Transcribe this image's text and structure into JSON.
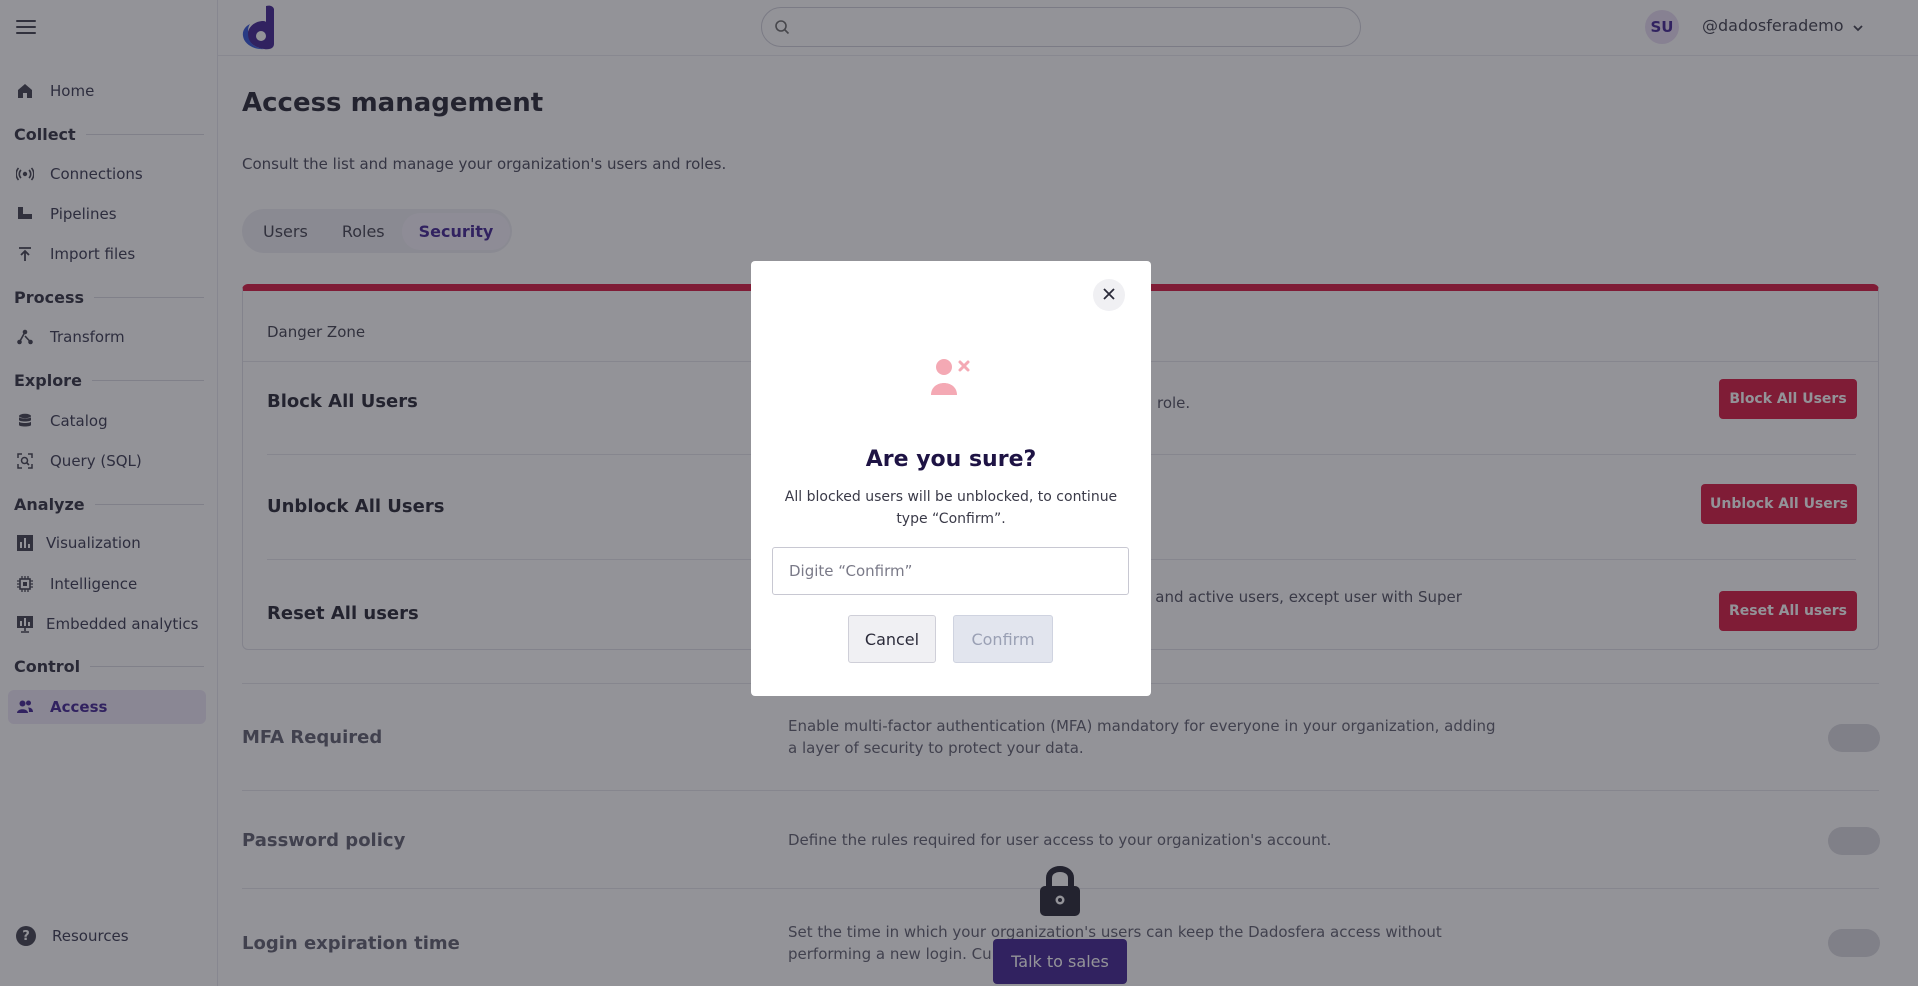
{
  "sidebar": {
    "home": "Home",
    "sections": {
      "collect": "Collect",
      "process": "Process",
      "explore": "Explore",
      "analyze": "Analyze",
      "control": "Control"
    },
    "items": {
      "connections": "Connections",
      "pipelines": "Pipelines",
      "import_files": "Import files",
      "transform": "Transform",
      "catalog": "Catalog",
      "query": "Query (SQL)",
      "visualization": "Visualization",
      "intelligence": "Intelligence",
      "embedded": "Embedded analytics",
      "access": "Access"
    },
    "resources": "Resources"
  },
  "header": {
    "avatar_initials": "SU",
    "username": "@dadosferademo"
  },
  "page": {
    "title": "Access management",
    "subtitle": "Consult the list and manage your organization's users and roles.",
    "tabs": [
      "Users",
      "Roles",
      "Security"
    ],
    "active_tab": "Security"
  },
  "danger_zone": {
    "title": "Danger Zone",
    "rows": [
      {
        "title": "Block All Users",
        "desc": "role.",
        "button": "Block All Users"
      },
      {
        "title": "Unblock All Users",
        "desc": "",
        "button": "Unblock All Users"
      },
      {
        "title": "Reset All users",
        "desc": "g and active users, except user with Super",
        "button": "Reset All users"
      }
    ]
  },
  "features": [
    {
      "title": "MFA Required",
      "desc": "Enable multi-factor authentication (MFA) mandatory for everyone in your organization, adding a layer of security to protect your data."
    },
    {
      "title": "Password policy",
      "desc": "Define the rules required for user access to your organization's account."
    },
    {
      "title": "Login expiration time",
      "desc": "Set the time in which your organization's users can keep the Dadosfera access without performing a new login. Curr          4 hours."
    }
  ],
  "talk_to_sales": "Talk to sales",
  "modal": {
    "title": "Are you sure?",
    "text": "All blocked users will be unblocked, to continue type “Confirm”.",
    "input_placeholder": "Digite “Confirm”",
    "cancel": "Cancel",
    "confirm": "Confirm"
  },
  "colors": {
    "brand": "#3b1d8f",
    "danger": "#d7113b",
    "icon_pink": "#f4a9b4"
  }
}
